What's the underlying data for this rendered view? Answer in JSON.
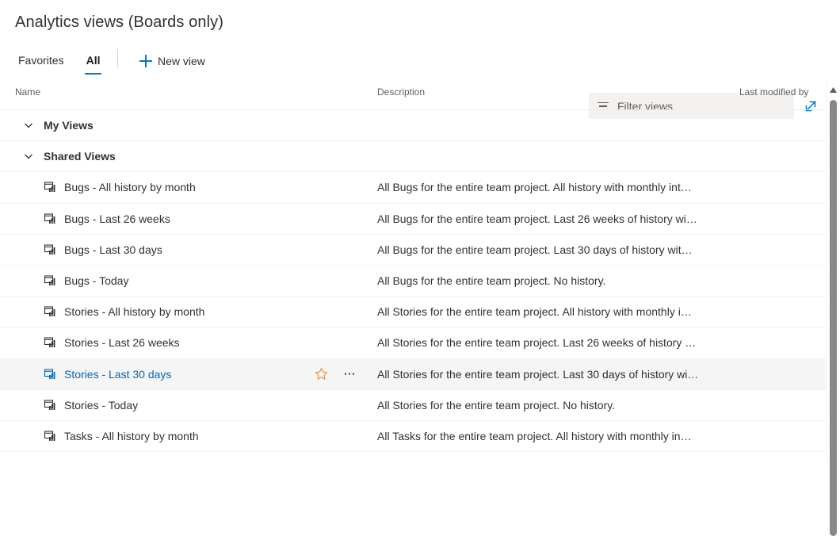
{
  "header": {
    "title": "Analytics views (Boards only)"
  },
  "commandbar": {
    "pivots": [
      {
        "label": "Favorites",
        "active": false
      },
      {
        "label": "All",
        "active": true
      }
    ],
    "new_view_label": "New view",
    "new_view_icon": "plus-icon",
    "filter": {
      "placeholder": "Filter views",
      "value": "",
      "icon": "filter-icon"
    },
    "expand_icon": "expand-diagonal-arrows-icon",
    "accent_color": "#0078d4"
  },
  "table": {
    "columns": [
      {
        "key": "name",
        "label": "Name"
      },
      {
        "key": "description",
        "label": "Description"
      },
      {
        "key": "modified",
        "label": "Last modified by"
      }
    ],
    "groups": [
      {
        "label": "My Views",
        "expanded": true,
        "chevron": "chevron-down-icon"
      },
      {
        "label": "Shared Views",
        "expanded": true,
        "chevron": "chevron-down-icon"
      }
    ],
    "rows": [
      {
        "type": "group",
        "label": "My Views",
        "chevron": "chevron-down-icon"
      },
      {
        "type": "group",
        "label": "Shared Views",
        "chevron": "chevron-down-icon"
      },
      {
        "type": "item",
        "icon": "analytics-view-icon",
        "name": "Bugs - All history by month",
        "description": "All Bugs for the entire team project. All history with monthly int…",
        "modified": "",
        "hovered": false
      },
      {
        "type": "item",
        "icon": "analytics-view-icon",
        "name": "Bugs - Last 26 weeks",
        "description": "All Bugs for the entire team project. Last 26 weeks of history wi…",
        "modified": "",
        "hovered": false
      },
      {
        "type": "item",
        "icon": "analytics-view-icon",
        "name": "Bugs - Last 30 days",
        "description": "All Bugs for the entire team project. Last 30 days of history wit…",
        "modified": "",
        "hovered": false
      },
      {
        "type": "item",
        "icon": "analytics-view-icon",
        "name": "Bugs - Today",
        "description": "All Bugs for the entire team project. No history.",
        "modified": "",
        "hovered": false
      },
      {
        "type": "item",
        "icon": "analytics-view-icon",
        "name": "Stories - All history by month",
        "description": "All Stories for the entire team project. All history with monthly i…",
        "modified": "",
        "hovered": false
      },
      {
        "type": "item",
        "icon": "analytics-view-icon",
        "name": "Stories - Last 26 weeks",
        "description": "All Stories for the entire team project. Last 26 weeks of history …",
        "modified": "",
        "hovered": false
      },
      {
        "type": "item",
        "icon": "analytics-view-icon",
        "name": "Stories - Last 30 days",
        "description": "All Stories for the entire team project. Last 30 days of history wi…",
        "modified": "",
        "hovered": true,
        "actions": [
          {
            "icon": "favorite-star-icon",
            "color": "#d98b3a"
          },
          {
            "icon": "more-options-ellipsis-icon",
            "color": "#605e5c"
          }
        ]
      },
      {
        "type": "item",
        "icon": "analytics-view-icon",
        "name": "Stories - Today",
        "description": "All Stories for the entire team project. No history.",
        "modified": "",
        "hovered": false
      },
      {
        "type": "item",
        "icon": "analytics-view-icon",
        "name": "Tasks - All history by month",
        "description": "All Tasks for the entire team project. All history with monthly in…",
        "modified": "",
        "hovered": false
      }
    ]
  },
  "scrollbar": {
    "up_icon": "scroll-up-arrow-icon",
    "thumb_color": "#8a8886"
  }
}
